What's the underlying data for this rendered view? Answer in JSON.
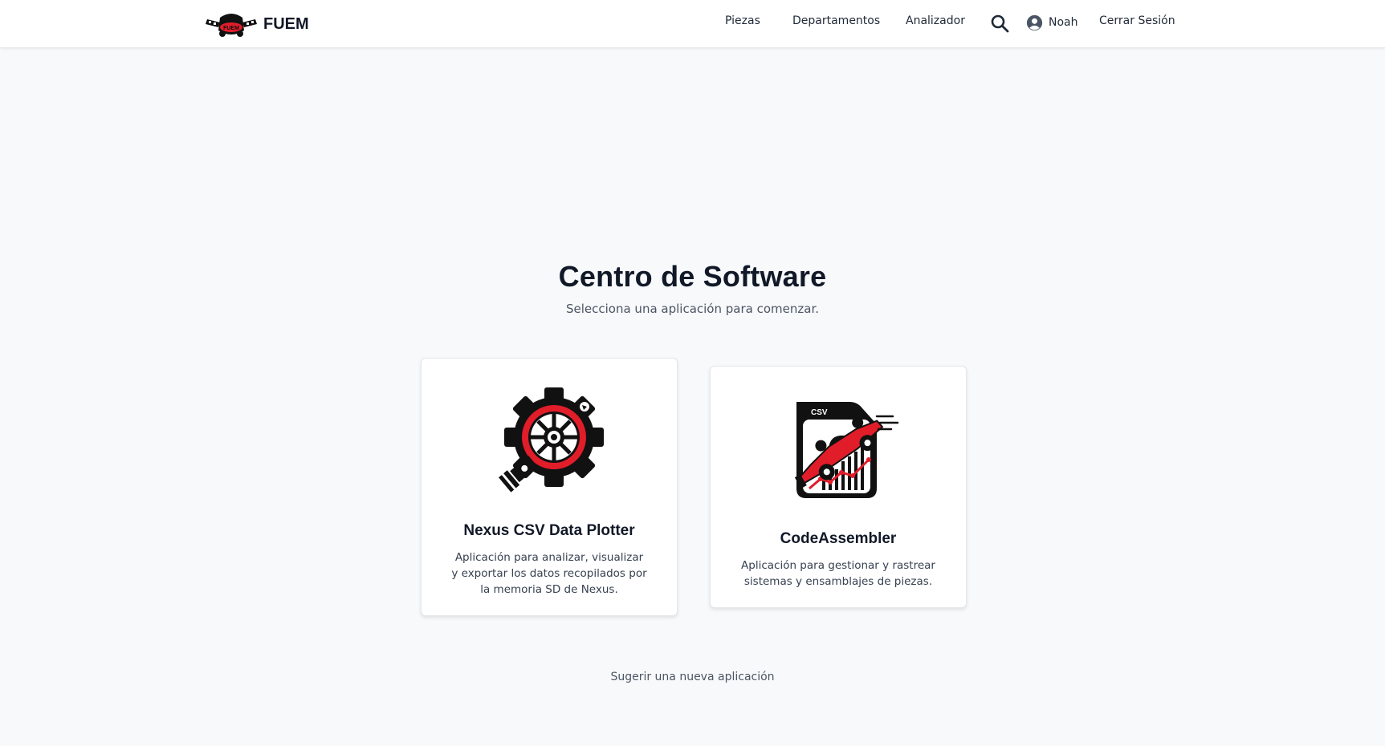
{
  "navbar": {
    "brand_name": "FUEM",
    "brand_logo_text": "FUEM",
    "links": [
      {
        "label": "Piezas"
      },
      {
        "label": "Departamentos"
      },
      {
        "label": "Analizador"
      }
    ],
    "search_icon": "search-icon",
    "user": {
      "icon": "user-circle-icon",
      "name": "Noah"
    },
    "logout_label": "Cerrar Sesión"
  },
  "main": {
    "title": "Centro de Software",
    "subtitle": "Selecciona una aplicación para comenzar.",
    "apps": [
      {
        "icon": "gear-wheel-icon",
        "title": "Nexus CSV Data Plotter",
        "description": "Aplicación para analizar, visualizar y exportar los datos recopilados por la memoria SD de Nexus."
      },
      {
        "icon": "csv-racecar-chart-icon",
        "icon_text": "CSV",
        "title": "CodeAssembler",
        "description": "Aplicación para gestionar y rastrear sistemas y ensamblajes de piezas."
      }
    ],
    "suggest_link": "Sugerir una nueva aplicación"
  },
  "colors": {
    "background": "#f8f9fb",
    "accent_red": "#e11d2a",
    "text_dark": "#111827",
    "text_muted": "#4b5563"
  }
}
